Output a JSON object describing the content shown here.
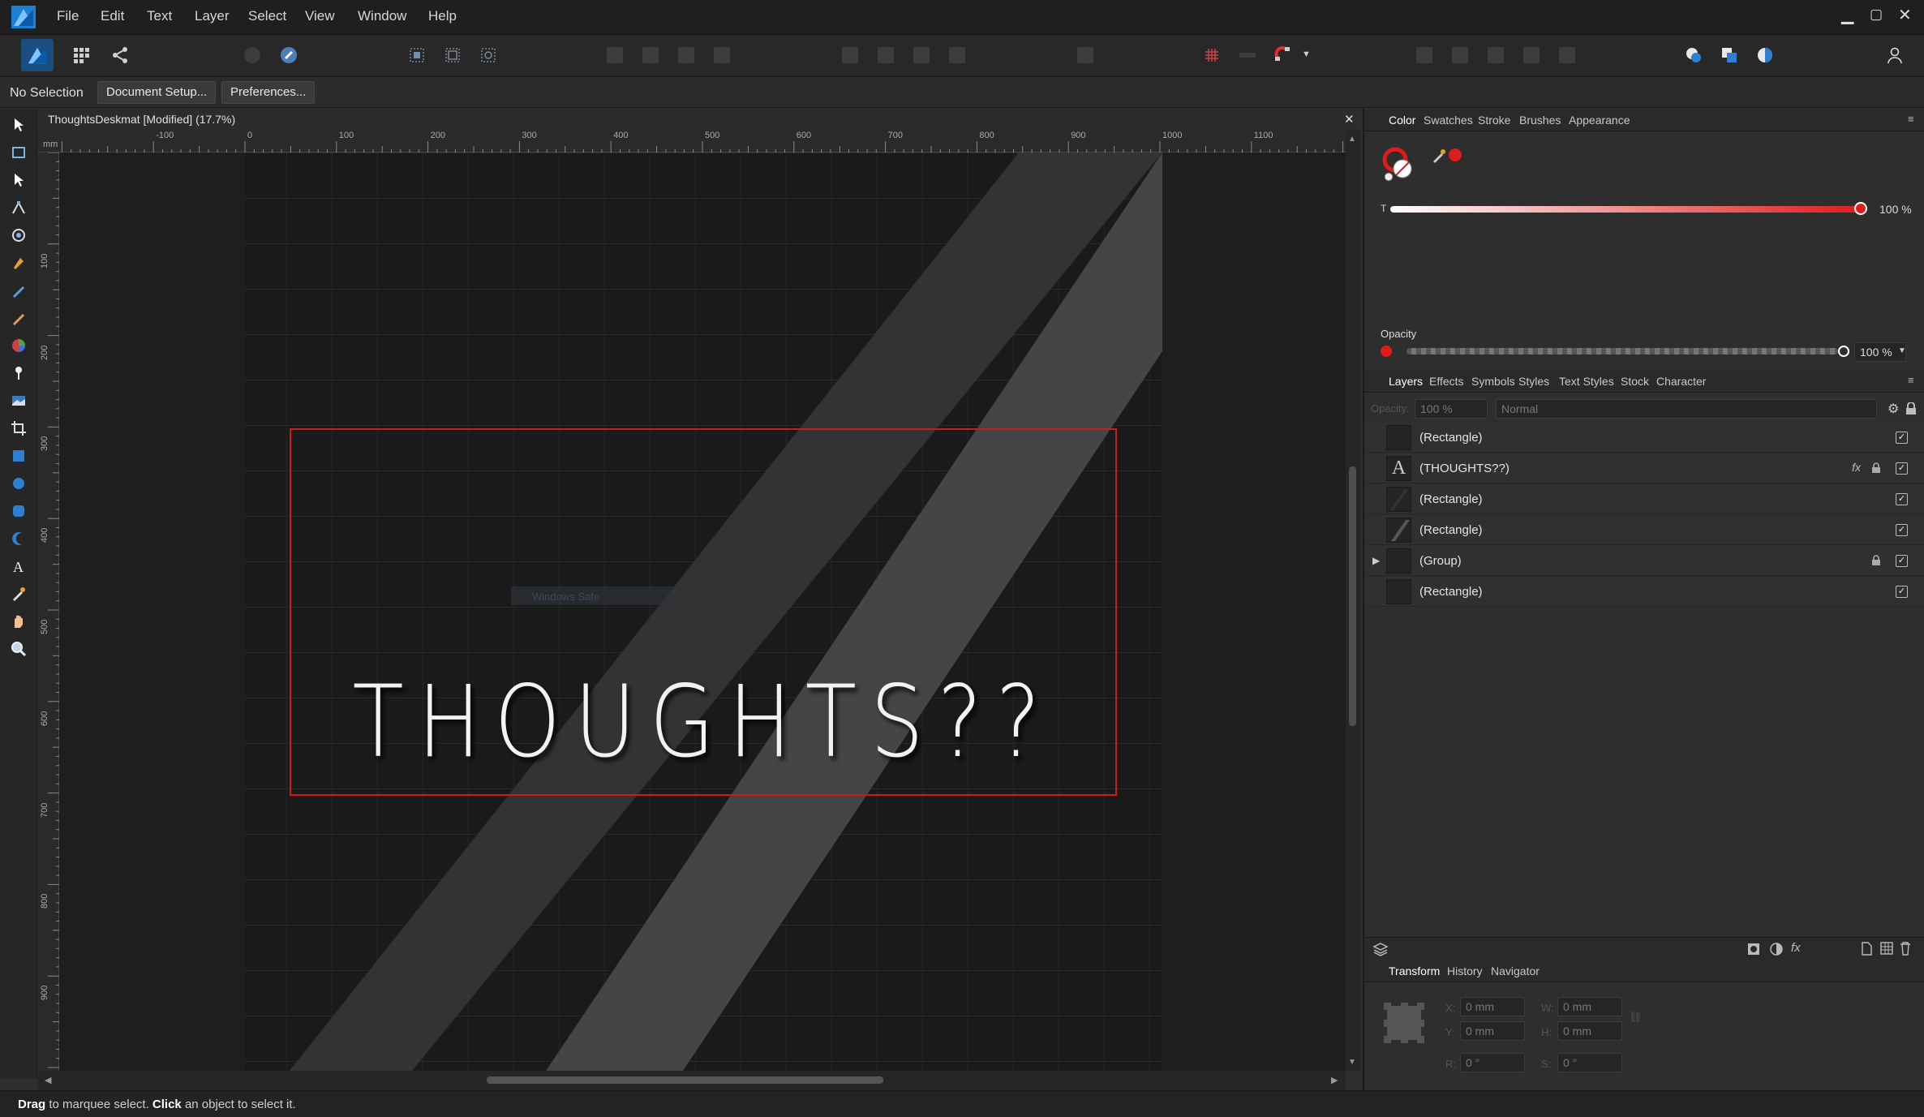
{
  "menu": [
    "File",
    "Edit",
    "Text",
    "Layer",
    "Select",
    "View",
    "Window",
    "Help"
  ],
  "context": {
    "selection": "No Selection",
    "document_setup": "Document Setup...",
    "preferences": "Preferences..."
  },
  "document": {
    "title": "ThoughtsDeskmat [Modified] (17.7%)"
  },
  "ruler": {
    "unit": "mm",
    "h_ticks": [
      "-100",
      "0",
      "100",
      "200",
      "300",
      "400",
      "500",
      "600",
      "700",
      "800",
      "900",
      "1000",
      "1100"
    ],
    "v_ticks": [
      "100",
      "200",
      "300",
      "400",
      "500",
      "600",
      "700",
      "800",
      "900"
    ]
  },
  "canvas": {
    "headline": "THOUGHTS??",
    "hidden_text": "Windows Safe"
  },
  "color_panel": {
    "tabs": [
      "Color",
      "Swatches",
      "Stroke",
      "Brushes",
      "Appearance"
    ],
    "t_label": "T",
    "t_value": "100 %",
    "opacity_label": "Opacity",
    "opacity_value": "100 %",
    "accent": "#e01b1b"
  },
  "layers_panel": {
    "tabs": [
      "Layers",
      "Effects",
      "Symbols",
      "Styles",
      "Text Styles",
      "Stock",
      "Character"
    ],
    "opacity_label": "Opacity:",
    "opacity_value": "100 %",
    "blend_mode": "Normal",
    "rows": [
      "(Rectangle)",
      "(THOUGHTS??)",
      "(Rectangle)",
      "(Rectangle)",
      "(Group)",
      "(Rectangle)"
    ],
    "fx_label": "fx"
  },
  "transform_panel": {
    "tabs": [
      "Transform",
      "History",
      "Navigator"
    ],
    "x_label": "X:",
    "x_value": "0 mm",
    "y_label": "Y:",
    "y_value": "0 mm",
    "w_label": "W:",
    "w_value": "0 mm",
    "h_label": "H:",
    "h_value": "0 mm",
    "r_label": "R:",
    "r_value": "0 °",
    "s_label": "S:",
    "s_value": "0 °"
  },
  "status": {
    "drag": "Drag",
    "drag_text": " to marquee select. ",
    "click": "Click",
    "click_text": " an object to select it."
  }
}
